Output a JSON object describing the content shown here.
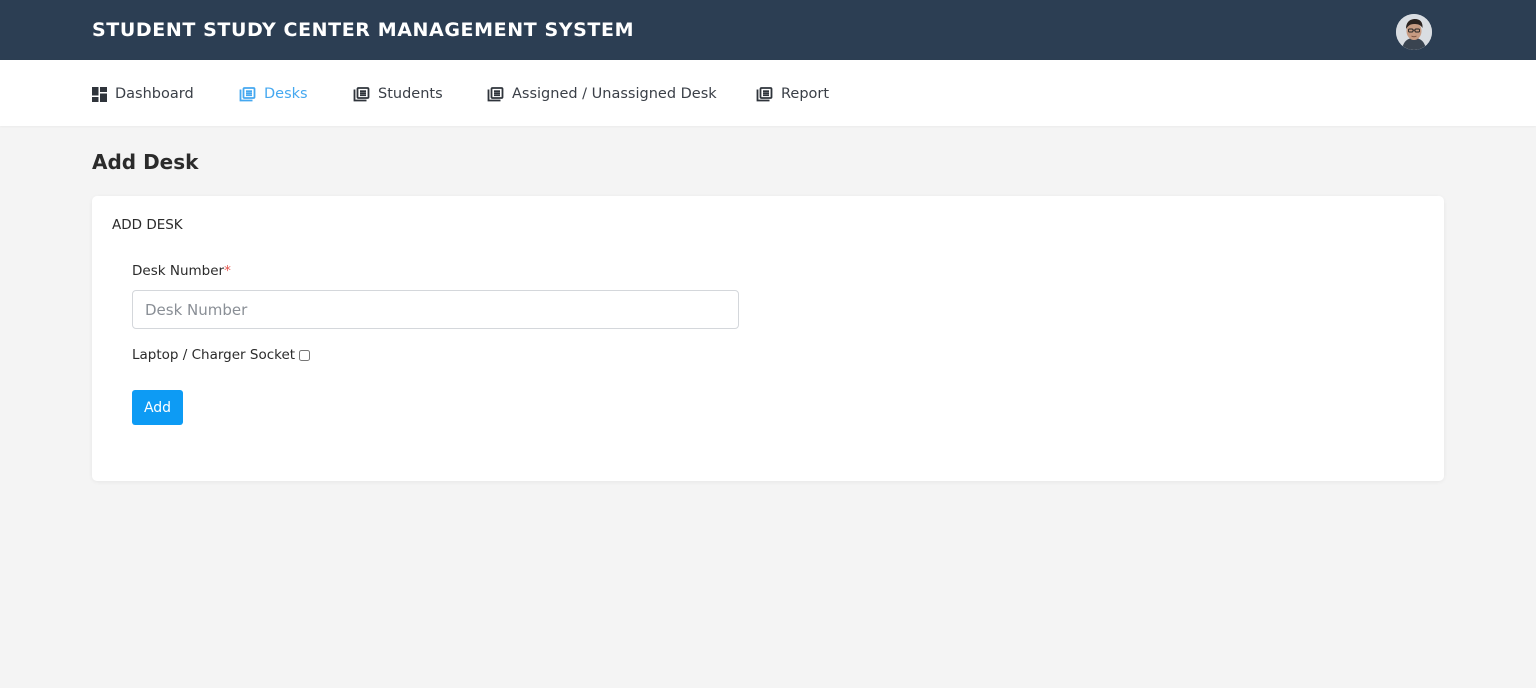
{
  "header": {
    "title": "STUDENT STUDY CENTER MANAGEMENT SYSTEM",
    "avatar_icon": "user-avatar-icon"
  },
  "nav": {
    "items": [
      {
        "label": "Dashboard",
        "icon": "dashboard-icon",
        "active": false
      },
      {
        "label": "Desks",
        "icon": "list-icon",
        "active": true
      },
      {
        "label": "Students",
        "icon": "list-icon",
        "active": false
      },
      {
        "label": "Assigned / Unassigned Desk",
        "icon": "list-icon",
        "active": false
      },
      {
        "label": "Report",
        "icon": "list-icon",
        "active": false
      }
    ],
    "active_color": "#45a8f0"
  },
  "page": {
    "heading": "Add Desk"
  },
  "form": {
    "card_title": "ADD DESK",
    "desk_number_label": "Desk Number",
    "required_mark": "*",
    "desk_number_placeholder": "Desk Number",
    "desk_number_value": "",
    "socket_label": "Laptop / Charger Socket",
    "socket_checked": false,
    "submit_label": "Add"
  },
  "colors": {
    "topbar": "#2c3e53",
    "button": "#0d9bf4",
    "background": "#f4f4f4"
  }
}
